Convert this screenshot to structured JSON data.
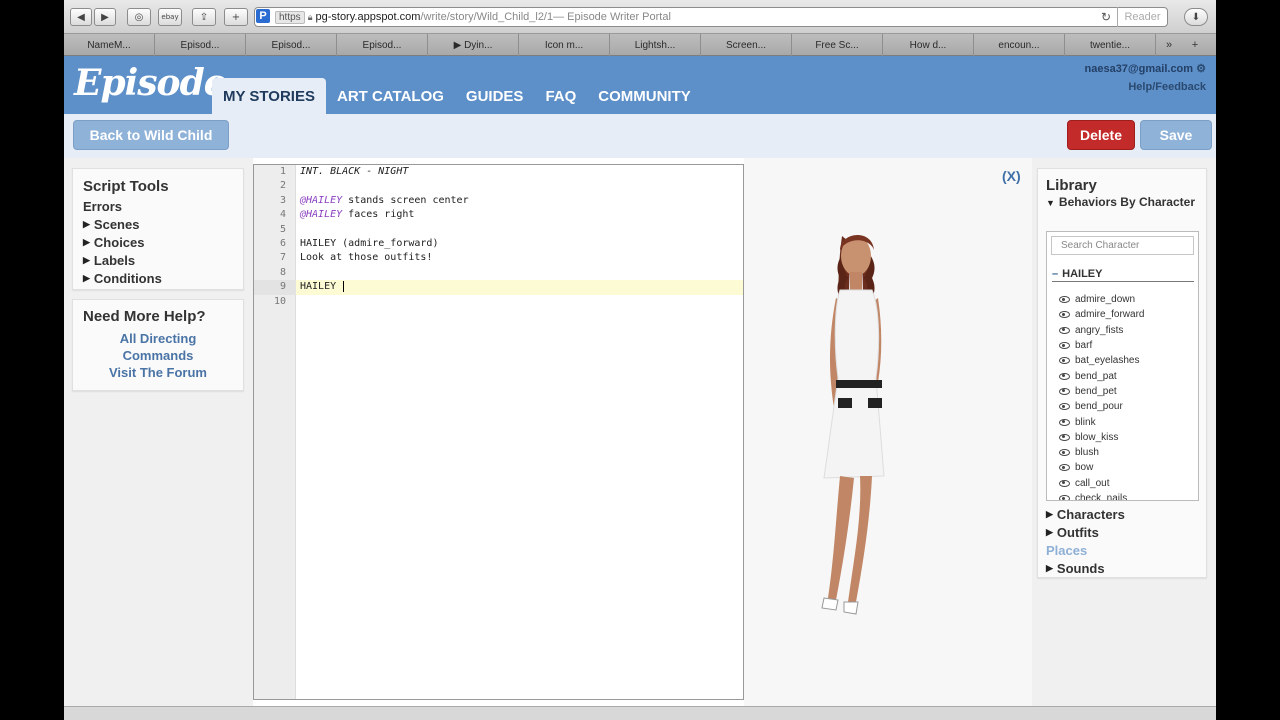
{
  "browser": {
    "pinned_label": "P",
    "https_label": "https",
    "url_host": "pg-story.appspot.com",
    "url_path": "/write/story/Wild_Child_l2/1",
    "page_title": " — Episode Writer Portal",
    "reader_label": "Reader",
    "buttons": [
      "◀",
      "▶",
      "◎",
      "ebay",
      "⇪",
      "+"
    ],
    "bookmarks": [
      "NameM...",
      "Episod...",
      "Episod...",
      "Episod...",
      "▶ Dyin...",
      "Icon m...",
      "Lightsh...",
      "Screen...",
      "Free Sc...",
      "How d...",
      "encoun...",
      "twentie..."
    ],
    "bookmarks_more": "»",
    "bookmarks_plus": "+"
  },
  "header": {
    "logo": "Episode",
    "nav": [
      "MY STORIES",
      "ART CATALOG",
      "GUIDES",
      "FAQ",
      "COMMUNITY"
    ],
    "email": "naesa37@gmail.com",
    "help": "Help/Feedback"
  },
  "actions": {
    "back": "Back to Wild Child",
    "delete": "Delete",
    "save": "Save"
  },
  "script_tools": {
    "title": "Script Tools",
    "errors": "Errors",
    "items": [
      "Scenes",
      "Choices",
      "Labels",
      "Conditions"
    ]
  },
  "help": {
    "title": "Need More Help?",
    "links": [
      "All Directing",
      "Commands",
      "Visit The Forum"
    ]
  },
  "editor": {
    "lines": [
      {
        "num": "1",
        "text": "INT. BLACK - NIGHT"
      },
      {
        "num": "2",
        "text": ""
      },
      {
        "num": "3",
        "char": "@HAILEY",
        "text": " stands screen center"
      },
      {
        "num": "4",
        "char": "@HAILEY",
        "text": " faces right"
      },
      {
        "num": "5",
        "text": ""
      },
      {
        "num": "6",
        "text": "HAILEY (admire_forward)"
      },
      {
        "num": "7",
        "text": "Look at those outfits!"
      },
      {
        "num": "8",
        "text": ""
      },
      {
        "num": "9",
        "text": "HAILEY "
      },
      {
        "num": "10",
        "text": ""
      }
    ]
  },
  "preview": {
    "close": "(X)"
  },
  "library": {
    "title": "Library",
    "behaviors_header": "Behaviors By Character",
    "search_placeholder": "Search Character",
    "character": "HAILEY",
    "behaviors": [
      "admire_down",
      "admire_forward",
      "angry_fists",
      "barf",
      "bat_eyelashes",
      "bend_pat",
      "bend_pet",
      "bend_pour",
      "blink",
      "blow_kiss",
      "blush",
      "bow",
      "call_out",
      "check_nails"
    ],
    "sections": [
      "Characters",
      "Outfits",
      "Places",
      "Sounds"
    ]
  },
  "colors": {
    "header_blue": "#5d8fc9",
    "action_bar": "#e6edf6",
    "delete_red": "#c32a2a",
    "button_blue": "#8fb2d8",
    "link_blue": "#4a74a6",
    "character_purple": "#8a3fbf"
  }
}
